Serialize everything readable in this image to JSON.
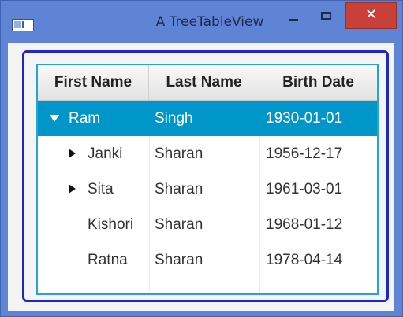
{
  "window": {
    "title": "A TreeTableView",
    "minimize_glyph": "",
    "maximize_glyph": "",
    "close_glyph": "✕"
  },
  "table": {
    "columns": [
      "First Name",
      "Last Name",
      "Birth Date"
    ],
    "rows": [
      {
        "first": "Ram",
        "last": "Singh",
        "birth": "1930-01-01",
        "level": 0,
        "disclosure": "expanded",
        "selected": true
      },
      {
        "first": "Janki",
        "last": "Sharan",
        "birth": "1956-12-17",
        "level": 1,
        "disclosure": "collapsed",
        "selected": false
      },
      {
        "first": "Sita",
        "last": "Sharan",
        "birth": "1961-03-01",
        "level": 1,
        "disclosure": "collapsed",
        "selected": false
      },
      {
        "first": "Kishori",
        "last": "Sharan",
        "birth": "1968-01-12",
        "level": 1,
        "disclosure": "none",
        "selected": false
      },
      {
        "first": "Ratna",
        "last": "Sharan",
        "birth": "1978-04-14",
        "level": 1,
        "disclosure": "none",
        "selected": false
      }
    ]
  },
  "colors": {
    "title_bar": "#5f84d6",
    "close_button": "#c9403a",
    "selection": "#0096c9",
    "focus_ring": "#1f25c9",
    "table_border": "#27a4d3"
  }
}
